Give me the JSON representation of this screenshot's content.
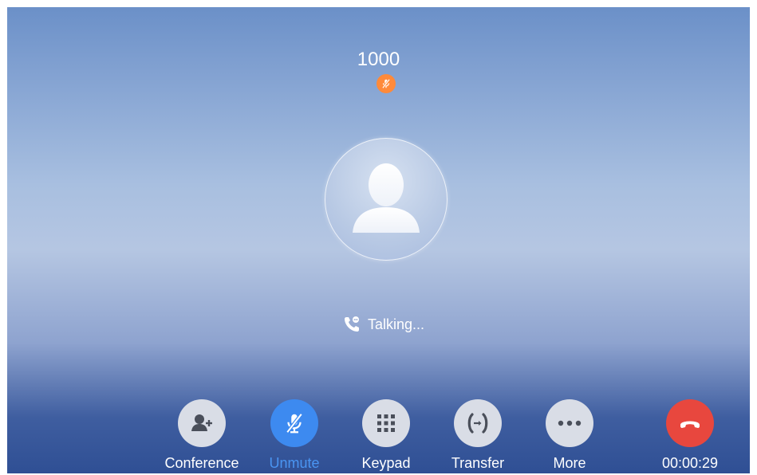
{
  "call": {
    "caller": "1000",
    "status": "Talking...",
    "duration": "00:00:29"
  },
  "controls": [
    {
      "label": "Conference",
      "icon": "add-contact-icon"
    },
    {
      "label": "Unmute",
      "icon": "microphone-muted-icon",
      "active": true
    },
    {
      "label": "Keypad",
      "icon": "keypad-grid-icon"
    },
    {
      "label": "Transfer",
      "icon": "transfer-call-icon"
    },
    {
      "label": "More",
      "icon": "more-dots-icon"
    }
  ],
  "hangup": {
    "icon": "end-call-icon"
  },
  "colors": {
    "accent": "#3d8af0",
    "hangup": "#e8473e",
    "mute_badge": "#ff8a3a",
    "button_gray": "#d9dde6"
  }
}
